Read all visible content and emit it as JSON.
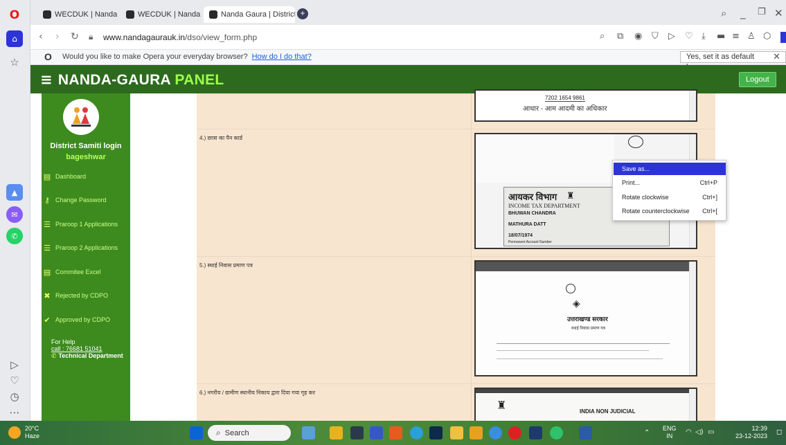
{
  "browser": {
    "tabs": [
      {
        "label": "WECDUK | Nanda Gaura"
      },
      {
        "label": "WECDUK | Nanda Gaura"
      },
      {
        "label": "Nanda Gaura | District Sam"
      }
    ],
    "new_tab_symbol": "+",
    "url_domain": "www.nandagaurauk.in",
    "url_path": "/dso/view_form.php",
    "infobar_message": "Would you like to make Opera your everyday browser?",
    "infobar_link": "How do I do that?",
    "infobar_button": "Yes, set it as default browser"
  },
  "header": {
    "brand_main": "NANDA-GAURA",
    "brand_accent": "PANEL",
    "logout": "Logout"
  },
  "sidebar": {
    "title": "District Samiti login",
    "subtitle": "bageshwar",
    "items": [
      {
        "label": "Dashboard",
        "icon": "table-icon"
      },
      {
        "label": "Change Password",
        "icon": "key-icon"
      },
      {
        "label": "Praroop 1 Applications",
        "icon": "list-icon"
      },
      {
        "label": "Praroop 2 Applications",
        "icon": "list-icon"
      },
      {
        "label": "Commitee Excel",
        "icon": "table-icon"
      },
      {
        "label": "Rejected by CDPO",
        "icon": "cross-icon"
      },
      {
        "label": "Approved by CDPO",
        "icon": "check-icon"
      }
    ],
    "help_title": "For Help",
    "help_call": "call : 76681 51041",
    "help_dept": "Technical Department"
  },
  "documents": [
    {
      "label": "4.) छात्रा का पैन कार्ड",
      "doc_text": [
        "आयकर विभाग",
        "INCOME TAX DEPARTMENT",
        "BHUWAN CHANDRA",
        "MATHURA DATT",
        "18/07/1974",
        "Permanent Account Number"
      ]
    },
    {
      "label": "5.) स्थाई निवास प्रमाण पत्र",
      "doc_text": [
        "उत्तराखण्ड सरकार",
        "स्थाई निवास प्रमाण पत्र"
      ]
    },
    {
      "label": "6.) नगरीय / ग्रामीण स्थानीय निकाय द्वारा दिया गया गृह कर",
      "doc_text": [
        "INDIA NON JUDICIAL"
      ]
    }
  ],
  "top_doc_text": [
    "7202 1654 9861",
    "आधार - आम आदमी का अधिकार"
  ],
  "context_menu": [
    {
      "label": "Save as...",
      "shortcut": ""
    },
    {
      "label": "Print...",
      "shortcut": "Ctrl+P"
    },
    {
      "label": "Rotate clockwise",
      "shortcut": "Ctrl+]"
    },
    {
      "label": "Rotate counterclockwise",
      "shortcut": "Ctrl+["
    }
  ],
  "taskbar": {
    "weather_temp": "20°C",
    "weather_desc": "Haze",
    "search": "Search",
    "lang1": "ENG",
    "lang2": "IN",
    "time": "12:39",
    "date": "23-12-2023"
  }
}
